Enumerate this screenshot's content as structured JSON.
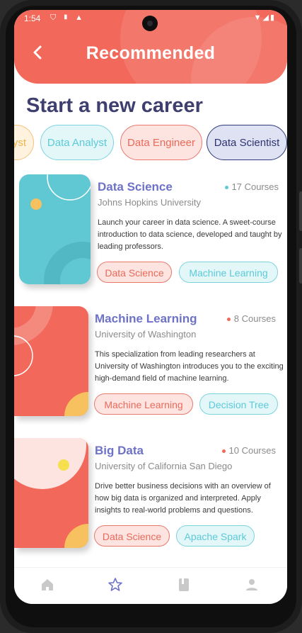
{
  "status_bar": {
    "time": "1:54",
    "icons": "⛉ ▮ ▲",
    "right": "▼◢▮"
  },
  "header": {
    "title": "Recommended",
    "back_icon": "chevron-left-icon"
  },
  "section_title": "Start a new career",
  "chips": [
    {
      "label": "alyst",
      "style": "orange"
    },
    {
      "label": "Data Analyst",
      "style": "cyan"
    },
    {
      "label": "Data Engineer",
      "style": "red"
    },
    {
      "label": "Data Scientist",
      "style": "indigo"
    }
  ],
  "courses": [
    {
      "title": "Data Science",
      "count": "17 Courses",
      "university": "Johns Hopkins University",
      "description": "Launch your career in data science. A sweet-course introduction to data science, developed and taught by leading professors.",
      "tags": [
        "Data Science",
        "Machine Learning"
      ],
      "accent": "#60c8d3"
    },
    {
      "title": "Machine Learning",
      "count": "8 Courses",
      "university": "University of Washington",
      "description": "This specialization from leading researchers at University of Washington introduces you to the exciting high-demand field of machine learning.",
      "tags": [
        "Machine Learning",
        "Decision Tree"
      ],
      "accent": "#f2685a"
    },
    {
      "title": "Big Data",
      "count": "10 Courses",
      "university": "University of California San Diego",
      "description": "Drive better business decisions with an overview of how big data is organized and interpreted. Apply insights to real-world problems and questions.",
      "tags": [
        "Data Science",
        "Apache Spark"
      ],
      "accent": "#f2685a"
    }
  ],
  "bottom_nav": [
    {
      "icon": "home-icon",
      "active": false
    },
    {
      "icon": "star-icon",
      "active": true
    },
    {
      "icon": "book-icon",
      "active": false
    },
    {
      "icon": "person-icon",
      "active": false
    }
  ],
  "colors": {
    "primary": "#f2685a",
    "title": "#3e3f6e",
    "course_title": "#6e72c7",
    "cyan": "#60c8d3"
  }
}
